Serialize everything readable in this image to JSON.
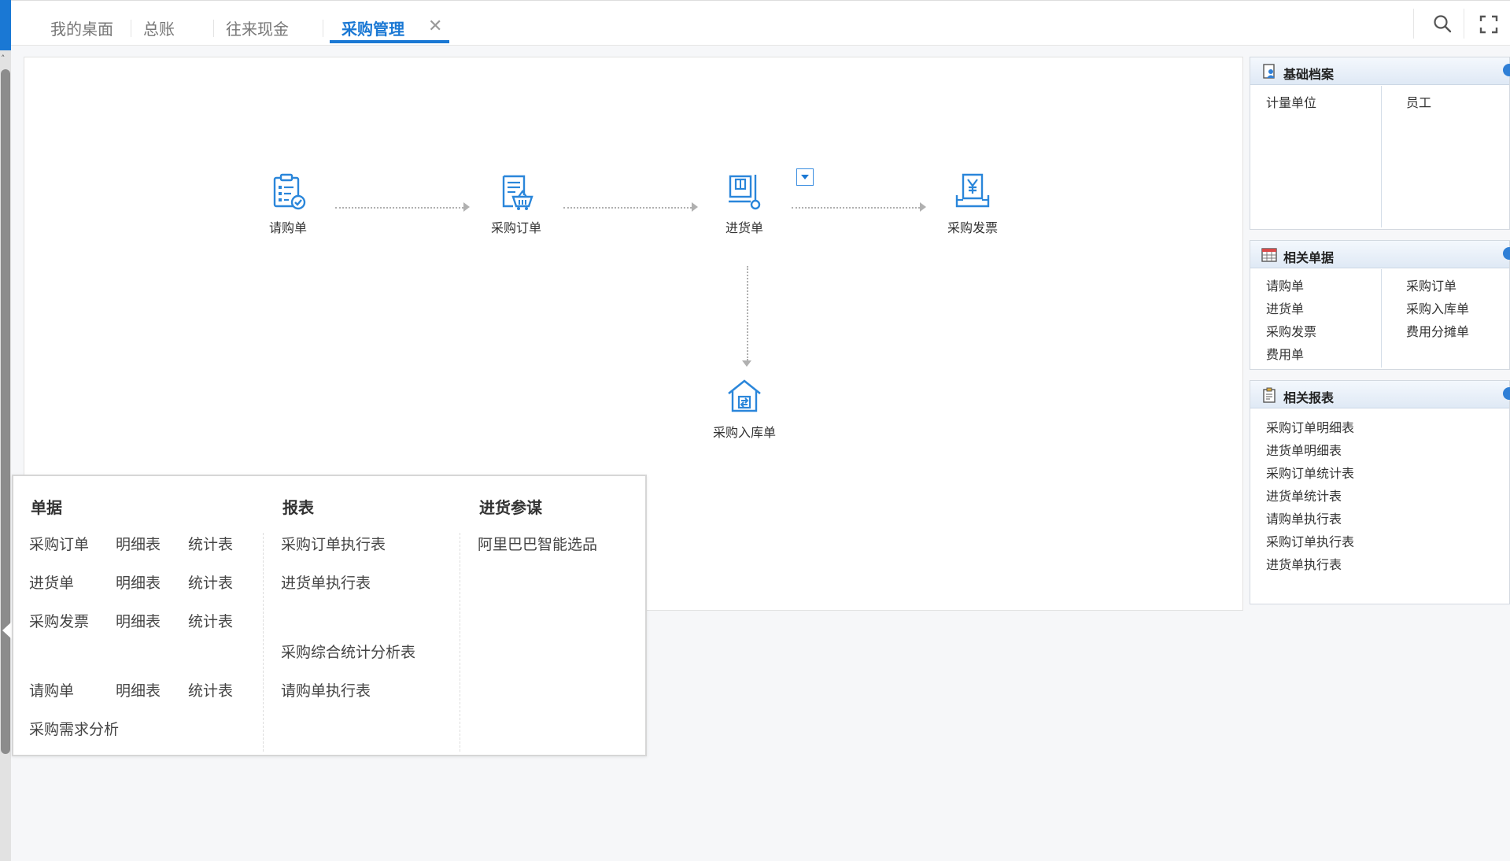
{
  "tabs": [
    {
      "label": "我的桌面"
    },
    {
      "label": "总账"
    },
    {
      "label": "往来现金"
    },
    {
      "label": "采购管理"
    }
  ],
  "active_tab": "采购管理",
  "close_glyph": "✕",
  "icons": {
    "search": "search-icon",
    "fullscreen": "fullscreen-icon"
  },
  "flow": {
    "nodes": [
      {
        "label": "请购单",
        "icon": "requisition-icon"
      },
      {
        "label": "采购订单",
        "icon": "purchase-order-icon"
      },
      {
        "label": "进货单",
        "icon": "receipt-icon"
      },
      {
        "label": "采购发票",
        "icon": "invoice-icon"
      },
      {
        "label": "采购入库单",
        "icon": "warehouse-in-icon"
      }
    ]
  },
  "popup": {
    "columns": [
      {
        "title": "单据"
      },
      {
        "title": "报表"
      },
      {
        "title": "进货参谋"
      }
    ],
    "docs": [
      [
        "采购订单",
        "明细表",
        "统计表"
      ],
      [
        "进货单",
        "明细表",
        "统计表"
      ],
      [
        "采购发票",
        "明细表",
        "统计表"
      ],
      [
        "请购单",
        "明细表",
        "统计表"
      ],
      [
        "采购需求分析"
      ]
    ],
    "reports": [
      "采购订单执行表",
      "进货单执行表",
      "采购综合统计分析表",
      "请购单执行表"
    ],
    "advisor": [
      "阿里巴巴智能选品"
    ]
  },
  "side": {
    "basic": {
      "title": "基础档案",
      "left": [
        "计量单位"
      ],
      "right": [
        "员工"
      ]
    },
    "related_docs": {
      "title": "相关单据",
      "left": [
        "请购单",
        "进货单",
        "采购发票",
        "费用单"
      ],
      "right": [
        "采购订单",
        "采购入库单",
        "费用分摊单"
      ]
    },
    "related_reports": {
      "title": "相关报表",
      "items": [
        "采购订单明细表",
        "进货单明细表",
        "采购订单统计表",
        "进货单统计表",
        "请购单执行表",
        "采购订单执行表",
        "进货单执行表"
      ]
    }
  },
  "colors": {
    "accent": "#1a78d4",
    "icon": "#2a86da",
    "dotted": "#b0b0b0"
  }
}
